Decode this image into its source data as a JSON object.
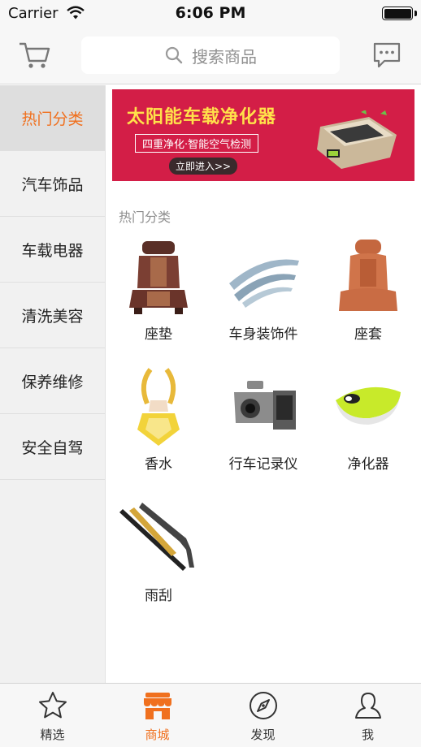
{
  "status_bar": {
    "carrier": "Carrier",
    "time": "6:06 PM"
  },
  "nav": {
    "search_placeholder": "搜索商品",
    "icons": {
      "cart": "cart-icon",
      "search": "search-icon",
      "message": "chat-bubble-icon"
    }
  },
  "sidebar": {
    "items": [
      {
        "label": "热门分类",
        "active": true
      },
      {
        "label": "汽车饰品",
        "active": false
      },
      {
        "label": "车载电器",
        "active": false
      },
      {
        "label": "清洗美容",
        "active": false
      },
      {
        "label": "保养维修",
        "active": false
      },
      {
        "label": "安全自驾",
        "active": false
      }
    ]
  },
  "banner": {
    "title": "太阳能车载净化器",
    "subtitle": "四重净化·智能空气检测",
    "cta": "立即进入>>"
  },
  "section": {
    "title": "热门分类",
    "items": [
      {
        "label": "座垫",
        "icon": "seat-cushion-image"
      },
      {
        "label": "车身装饰件",
        "icon": "window-visor-image"
      },
      {
        "label": "座套",
        "icon": "seat-cover-image"
      },
      {
        "label": "香水",
        "icon": "car-perfume-image"
      },
      {
        "label": "行车记录仪",
        "icon": "dash-cam-image"
      },
      {
        "label": "净化器",
        "icon": "air-purifier-image"
      },
      {
        "label": "雨刮",
        "icon": "wiper-blade-image"
      }
    ]
  },
  "tab_bar": {
    "tabs": [
      {
        "label": "精选",
        "icon": "star-icon",
        "active": false
      },
      {
        "label": "商城",
        "icon": "store-icon",
        "active": true
      },
      {
        "label": "发现",
        "icon": "compass-icon",
        "active": false
      },
      {
        "label": "我",
        "icon": "person-icon",
        "active": false
      }
    ]
  },
  "colors": {
    "accent": "#f0701e",
    "banner_bg": "#d31e47",
    "sidebar_bg": "#f1f1f1"
  }
}
